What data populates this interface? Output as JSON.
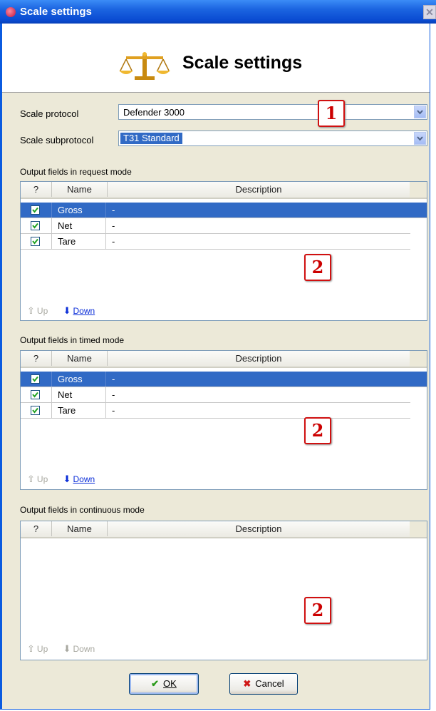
{
  "window": {
    "title": "Scale settings",
    "close_label": "✕"
  },
  "header": {
    "title": "Scale settings",
    "icon": "scale-icon"
  },
  "protocol": {
    "label": "Scale protocol",
    "value": "Defender 3000"
  },
  "subprotocol": {
    "label": "Scale subprotocol",
    "value": "T31 Standard"
  },
  "columns": {
    "check": "?",
    "name": "Name",
    "description": "Description"
  },
  "request": {
    "title": "Output fields in request mode",
    "rows": [
      {
        "name": "Gross",
        "description": "-",
        "checked": true
      },
      {
        "name": "Net",
        "description": "-",
        "checked": true
      },
      {
        "name": "Tare",
        "description": "-",
        "checked": true
      }
    ],
    "up": "Up",
    "down": "Down"
  },
  "timed": {
    "title": "Output fields in timed mode",
    "rows": [
      {
        "name": "Gross",
        "description": "-",
        "checked": true
      },
      {
        "name": "Net",
        "description": "-",
        "checked": true
      },
      {
        "name": "Tare",
        "description": "-",
        "checked": true
      }
    ],
    "up": "Up",
    "down": "Down"
  },
  "continuous": {
    "title": "Output fields in continuous mode",
    "rows": [],
    "up": "Up",
    "down": "Down"
  },
  "badges": {
    "one": "1",
    "two": "2"
  },
  "buttons": {
    "ok": "OK",
    "cancel": "Cancel"
  },
  "colors": {
    "title_bar": "#0a4bd2",
    "selection": "#316ac5",
    "badge_border": "#d01010",
    "window_bg": "#ece9d8"
  }
}
